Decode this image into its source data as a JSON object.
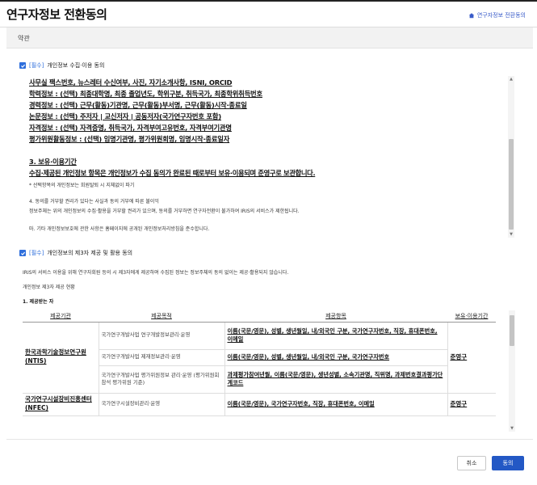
{
  "header": {
    "title": "연구자정보 전환동의",
    "breadcrumb": "연구자정보 전환동의"
  },
  "tab": {
    "label": "약관"
  },
  "section1": {
    "required_tag": "[필수]",
    "heading": "개인정보 수집·이용 동의",
    "bold_lines": [
      "사무실 팩스번호, 뉴스레터 수신여부, 사진, 자기소개사항, ISNI, ORCID",
      "학력정보 : (선택) 최종대학명, 최종 졸업년도, 학위구분, 취득국가, 최종학위취득번호",
      "경력정보 : (선택) 근무(활동)기관명, 근무(활동)부서명, 근무(활동)시작·종료일",
      "논문정보 : (선택) 주저자 | 교신저자 | 공동저자(국가연구자번호 포함)",
      "자격정보 : (선택) 자격증명, 취득국가, 자격부여고유번호, 자격부여기관명",
      "평가위원활동정보 : (선택) 임명기관명, 평가위원회명, 임명시작·종료일자"
    ],
    "retention_title": "3. 보유·이용기간",
    "retention_text": "수집·제공된 개인정보 항목은 개인정보가 수집 동의가 완료된 때로부터 보유·이용되며 준영구로 보관합니다.",
    "note": "* 선택항목의 개인정보는 회원탈퇴 시 지체없이 파기",
    "item4_title": "4. 동의를 거부할 권리가 있다는 사실과 동의 거부에 따른 불이익",
    "item4_text": "정보주체는 위의 개인정보의 수집·활용을 거부할 권리가 있으며, 동의를 거부하면 연구자전환이 불가하여 IRIS의 서비스가 제한됩니다.",
    "item5_text": "마. 기타 개인정보보호에 관한 사항은 홈페이지에 공개된 개인정보처리방침을 준수합니다."
  },
  "section2": {
    "required_tag": "[필수]",
    "heading": "개인정보의 제3자 제공 및 활용 동의",
    "intro": "IRIS의 서비스 이용을 위해 연구자회원 등의 시 제3자에게 제공하며 수집된 정보는 정보주체의 동의 없이는 제공·활용되지 않습니다.",
    "status_label": "개인정보 제3자 제공 현황",
    "sub_title": "1. 제공받는 자",
    "table": {
      "headers": [
        "제공기관",
        "제공목적",
        "제공항목",
        "보유·이용기간"
      ],
      "groups": [
        {
          "institution": "한국과학기술정보연구원(NTIS)",
          "rows": [
            {
              "purpose": "국가연구개발사업 연구개발정보관리·운영",
              "items": "이름(국문/영문), 성별, 생년월일, 내/외국인 구분, 국가연구자번호, 직장, 휴대폰번호, 이메일"
            },
            {
              "purpose": "국가연구개발사업 제재정보관리·운영",
              "items": "이름(국문/영문), 성별, 생년월일, 내/외국인 구분, 국가연구자번호"
            },
            {
              "purpose": "국가연구개발사업 평가위원정보 관리·운영 (평가위원회 참석 평가위원 기준)",
              "items": "과제평가참여년월, 이름(국문/영문), 생년성별, 소속기관명, 직위명, 과제번호결과평가단계코드"
            }
          ],
          "period": "준영구"
        },
        {
          "institution": "국가연구시설장비진흥센터(NFEC)",
          "rows": [
            {
              "purpose": "국가연구시설장비관리·운영",
              "items": "이름(국문/영문), 국가연구자번호, 직장, 휴대폰번호, 이메일"
            }
          ],
          "period": "준영구"
        }
      ]
    }
  },
  "footer": {
    "cancel_label": "취소",
    "agree_label": "동의"
  },
  "colors": {
    "accent": "#2358c5",
    "link": "#3a5cc9"
  },
  "icons": {
    "breadcrumb": "home-icon",
    "checkbox": "checkbox-checked-icon"
  }
}
